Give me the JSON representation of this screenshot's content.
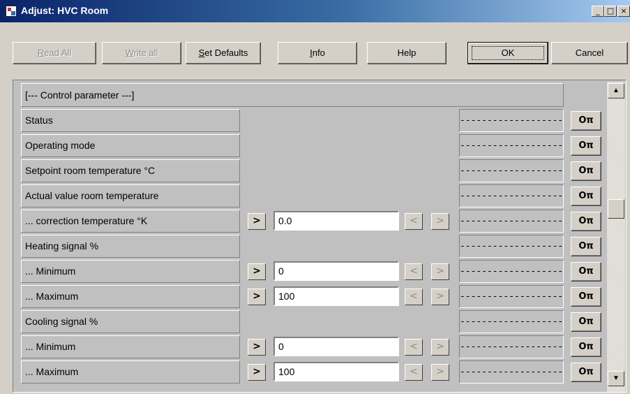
{
  "window": {
    "title": "Adjust: HVC Room",
    "controls": [
      "_",
      "□",
      "×"
    ]
  },
  "toolbar": [
    {
      "mnemonic": "R",
      "rest": "ead All",
      "enabled": false
    },
    {
      "mnemonic": "W",
      "rest": "rite all",
      "enabled": false
    },
    {
      "mnemonic": "S",
      "rest": "et Defaults",
      "enabled": true
    },
    {
      "mnemonic": "I",
      "rest": "nfo",
      "enabled": true
    },
    {
      "mnemonic": "",
      "rest": "Help",
      "enabled": true
    },
    {
      "mnemonic": "",
      "rest": "OK",
      "enabled": true,
      "default": true
    },
    {
      "mnemonic": "",
      "rest": "Cancel",
      "enabled": true
    }
  ],
  "section_header": "[--- Control parameter ---]",
  "glyphs": {
    "set": ">",
    "prev": "<",
    "next": ">",
    "key": "Oπ",
    "scroll_up": "▲",
    "scroll_down": "▼"
  },
  "rows": [
    {
      "label": "Status",
      "dash": "----------------------",
      "editable": false
    },
    {
      "label": "Operating mode",
      "dash": "----------------------",
      "editable": false
    },
    {
      "label": "Setpoint room temperature °C",
      "dash": "----------------------",
      "editable": false
    },
    {
      "label": "Actual value room temperature",
      "dash": "----------------------",
      "editable": false
    },
    {
      "label": "... correction temperature °K",
      "value": "0.0",
      "dash": "----------------------",
      "editable": true
    },
    {
      "label": "Heating signal %",
      "dash": "----------------------",
      "editable": false
    },
    {
      "label": "... Minimum",
      "value": "0",
      "dash": "----------------------",
      "editable": true
    },
    {
      "label": "... Maximum",
      "value": "100",
      "dash": "----------------------",
      "editable": true
    },
    {
      "label": "Cooling signal %",
      "dash": "----------------------",
      "editable": false
    },
    {
      "label": "... Minimum",
      "value": "0",
      "dash": "----------------------",
      "editable": true
    },
    {
      "label": "... Maximum",
      "value": "100",
      "dash": "----------------------",
      "editable": true
    }
  ]
}
